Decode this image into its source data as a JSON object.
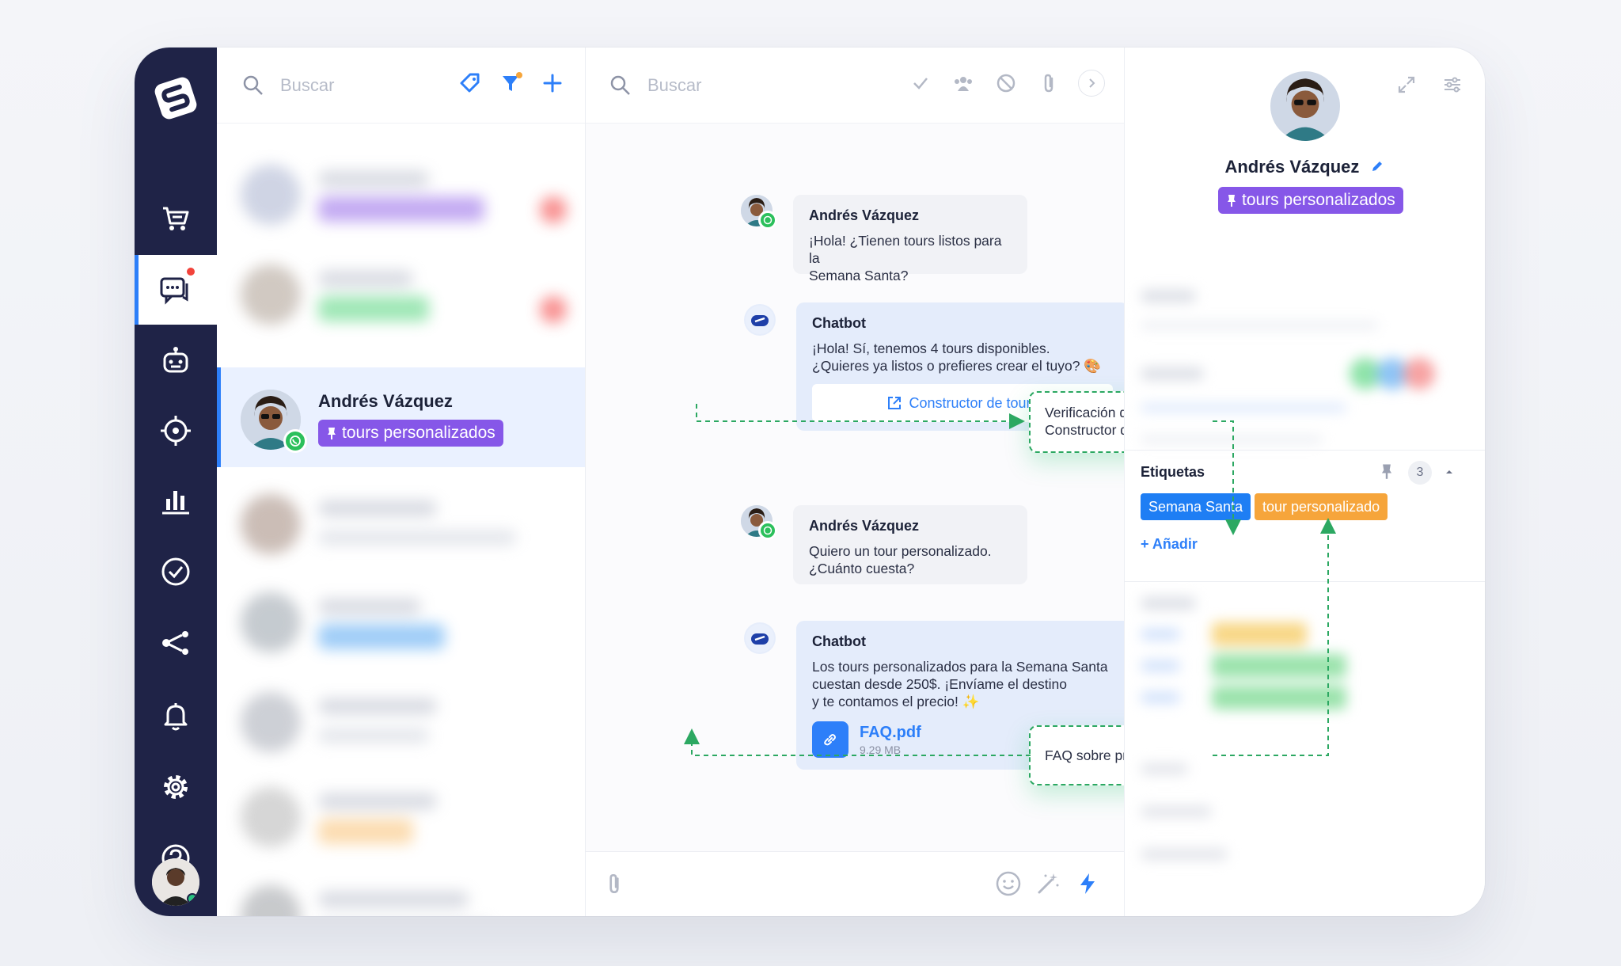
{
  "colors": {
    "nav_bg": "#1f2347",
    "accent_blue": "#2d7ff9",
    "tag_purple": "#8657e8",
    "chip_blue": "#1e7ef4",
    "chip_orange": "#f6a53b",
    "annotation_green": "#2ca862",
    "whatsapp_green": "#2cc05c"
  },
  "nav": {
    "logo_icon": "app-logo-icon",
    "items": [
      {
        "name": "cart-icon"
      },
      {
        "name": "chat-icon",
        "active": true
      },
      {
        "name": "bot-icon"
      },
      {
        "name": "target-icon"
      },
      {
        "name": "chart-icon"
      },
      {
        "name": "check-circle-icon"
      },
      {
        "name": "share-icon"
      },
      {
        "name": "bell-icon"
      },
      {
        "name": "gear-icon"
      },
      {
        "name": "help-icon"
      }
    ]
  },
  "list": {
    "search_placeholder": "Buscar",
    "active_conversation": {
      "name": "Andrés Vázquez",
      "tag": "tours personalizados"
    }
  },
  "chat": {
    "search_placeholder": "Buscar",
    "messages": [
      {
        "author": "Andrés Vázquez",
        "text": "¡Hola! ¿Tienen tours listos para la\nSemana Santa?"
      },
      {
        "author": "Chatbot",
        "text": "¡Hola! Sí, tenemos 4 tours disponibles.\n¿Quieres ya listos o prefieres crear el tuyo? 🎨",
        "button": "Constructor de tours"
      },
      {
        "author": "Andrés Vázquez",
        "text": "Quiero un tour personalizado.\n¿Cuánto cuesta?"
      },
      {
        "author": "Chatbot",
        "text": "Los tours personalizados para la Semana Santa\ncuestan desde 250$. ¡Envíame el destino\ny te contamos el precio! ✨",
        "file_name": "FAQ.pdf",
        "file_size": "9.29 MB"
      }
    ],
    "annotations": [
      "Verificación de base + [Semana Santa] +\nConstructor de tours",
      "FAQ sobre precio + [tour personalizado]"
    ]
  },
  "profile": {
    "name": "Andrés Vázquez",
    "tag": "tours personalizados",
    "labels_title": "Etiquetas",
    "labels_count": "3",
    "labels": [
      "Semana Santa",
      "tour personalizado"
    ],
    "add_label": "+ Añadir"
  }
}
